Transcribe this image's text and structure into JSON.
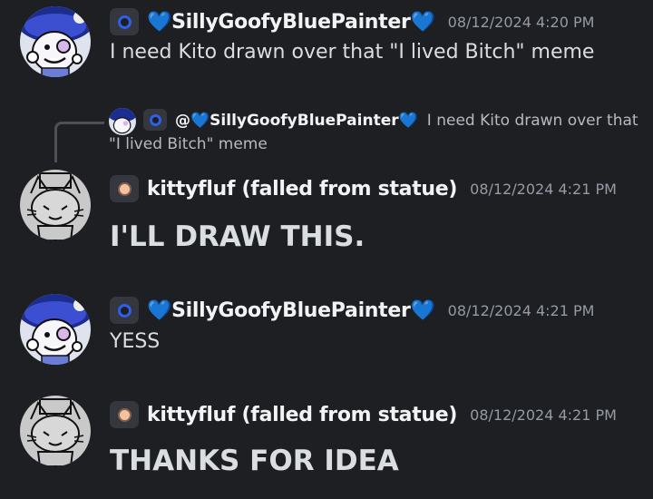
{
  "messages": [
    {
      "author": "💙SillyGoofyBluePainter💙",
      "timestamp": "08/12/2024 4:20 PM",
      "text": "I need Kito drawn over that \"I lived Bitch\" meme",
      "avatar": "blue-hat-character-avatar"
    },
    {
      "reply": {
        "mention": "@💙SillyGoofyBluePainter💙",
        "text": "I need Kito drawn over that \"I lived Bitch\" meme"
      },
      "author": "kittyfluf (falled from statue)",
      "timestamp": "08/12/2024 4:21 PM",
      "text": "I'LL DRAW THIS.",
      "avatar": "sketch-cat-avatar"
    },
    {
      "author": "💙SillyGoofyBluePainter💙",
      "timestamp": "08/12/2024 4:21 PM",
      "text": "YESS",
      "avatar": "blue-hat-character-avatar"
    },
    {
      "author": "kittyfluf (falled from statue)",
      "timestamp": "08/12/2024 4:21 PM",
      "text": "THANKS FOR IDEA",
      "avatar": "sketch-cat-avatar"
    }
  ],
  "colors": {
    "background": "#1e1f22",
    "name": "#f2f3f5",
    "timestamp": "#949ba4",
    "text": "#dbdee1",
    "heart": "#1b8cf0",
    "tag_blue": "#2f5fe8"
  }
}
